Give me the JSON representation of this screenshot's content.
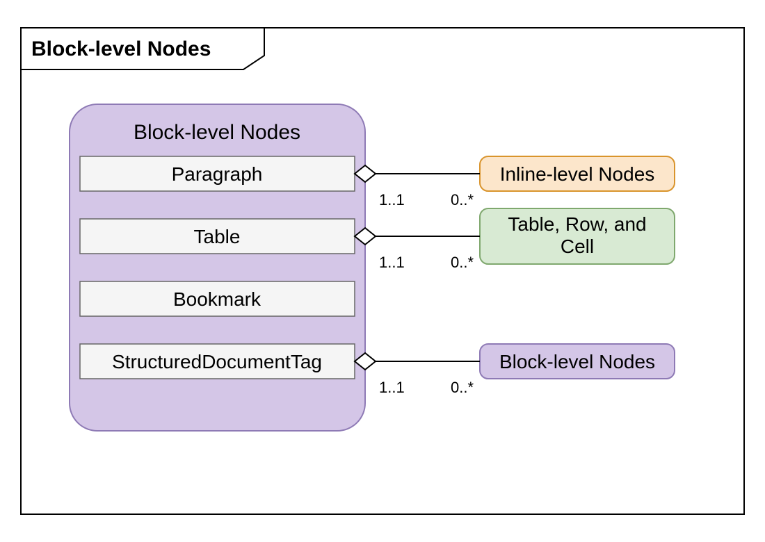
{
  "diagram": {
    "frameTitle": "Block-level Nodes",
    "container": {
      "title": "Block-level Nodes",
      "items": [
        {
          "label": "Paragraph"
        },
        {
          "label": "Table"
        },
        {
          "label": "Bookmark"
        },
        {
          "label": "StructuredDocumentTag"
        }
      ]
    },
    "targets": {
      "inline": {
        "label": "Inline-level Nodes"
      },
      "table": {
        "label": "Table, Row, and Cell"
      },
      "block": {
        "label": "Block-level Nodes"
      }
    },
    "associations": [
      {
        "from": "Paragraph",
        "to": "inline",
        "sourceMult": "1..1",
        "targetMult": "0..*"
      },
      {
        "from": "Table",
        "to": "table",
        "sourceMult": "1..1",
        "targetMult": "0..*"
      },
      {
        "from": "StructuredDocumentTag",
        "to": "block",
        "sourceMult": "1..1",
        "targetMult": "0..*"
      }
    ],
    "colors": {
      "containerFill": "#D4C6E7",
      "containerStroke": "#8E7AB5",
      "itemFill": "#F5F5F5",
      "itemStroke": "#666666",
      "inlineFill": "#FCE6CB",
      "inlineStroke": "#D9942C",
      "tableFill": "#D8EAD3",
      "tableStroke": "#7FA86E",
      "blockFill": "#D4C6E7",
      "blockStroke": "#8E7AB5",
      "line": "#000000"
    }
  }
}
